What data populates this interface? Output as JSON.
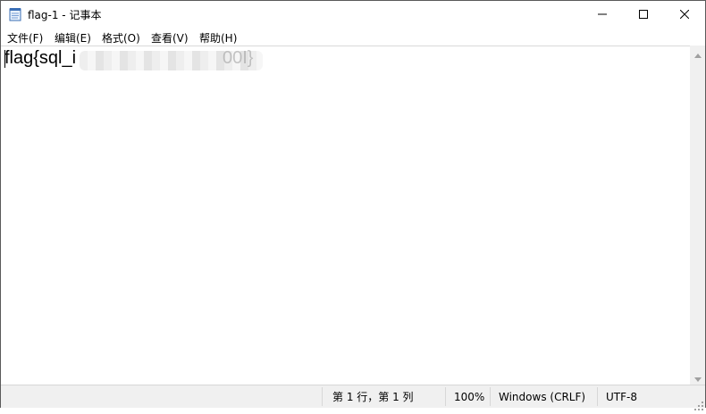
{
  "window": {
    "title": "flag-1 - 记事本"
  },
  "menu": [
    {
      "label": "文件(F)"
    },
    {
      "label": "编辑(E)"
    },
    {
      "label": "格式(O)"
    },
    {
      "label": "查看(V)"
    },
    {
      "label": "帮助(H)"
    }
  ],
  "editor": {
    "visible_text": "flag{sql_i",
    "visible_tail": "00I}"
  },
  "status": {
    "position": "第 1 行，第 1 列",
    "zoom": "100%",
    "line_ending": "Windows (CRLF)",
    "encoding": "UTF-8"
  },
  "icons": {
    "app": "notepad-icon",
    "minimize": "minimize-icon",
    "maximize": "maximize-icon",
    "close": "close-icon"
  }
}
